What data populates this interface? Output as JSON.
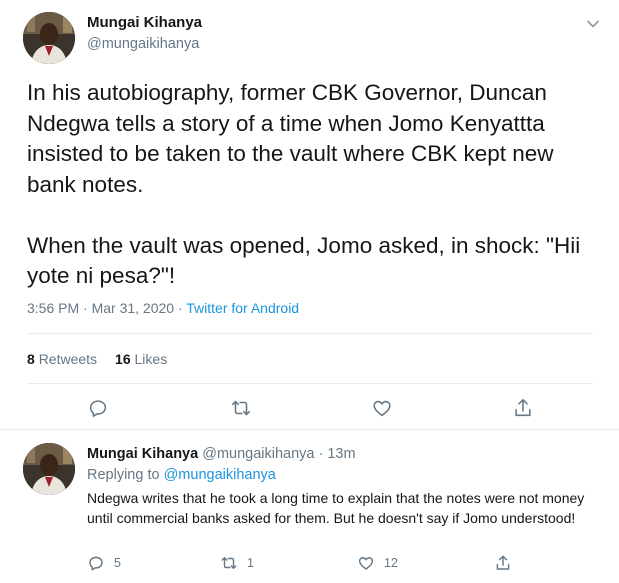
{
  "main_tweet": {
    "author_name": "Mungai Kihanya",
    "author_handle": "@mungaikihanya",
    "text": "In his autobiography, former CBK Governor, Duncan Ndegwa tells a story of a time when Jomo Kenyattta insisted to be taken to the vault where CBK kept new bank notes.\n\nWhen the vault was opened, Jomo asked, in shock: \"Hii yote ni pesa?\"!",
    "timestamp": "3:56 PM · Mar 31, 2020 · ",
    "source": "Twitter for Android",
    "retweets_count": "8",
    "retweets_label": "Retweets",
    "likes_count": "16",
    "likes_label": "Likes"
  },
  "reply_tweet": {
    "author_name": "Mungai Kihanya",
    "author_meta": "@mungaikihanya · 13m",
    "replying_prefix": "Replying to ",
    "replying_mention": "@mungaikihanya",
    "text": "Ndegwa writes that he took a long time to explain that the notes were not money until commercial banks asked for them. But he doesn't say if Jomo understood!",
    "reply_count": "5",
    "retweet_count": "1",
    "like_count": "12"
  },
  "icons": {
    "caret": "chevron-down-icon",
    "reply": "reply-icon",
    "retweet": "retweet-icon",
    "like": "heart-icon",
    "share": "share-icon"
  },
  "colors": {
    "text": "#14171a",
    "secondary": "#657786",
    "link": "#1b95e0",
    "divider": "#e6ecf0"
  }
}
